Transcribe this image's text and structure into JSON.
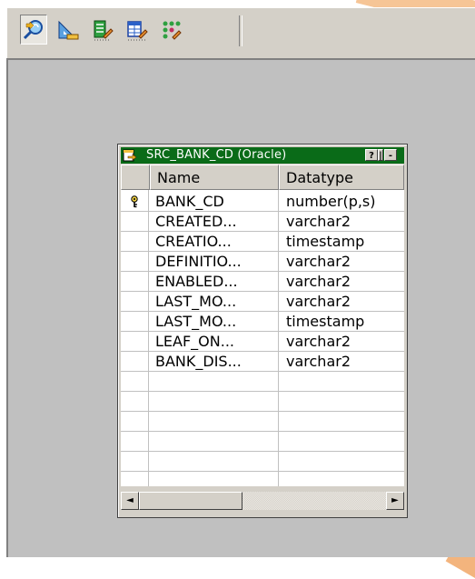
{
  "toolbar": {
    "buttons": [
      {
        "icon": "source-analyzer-icon",
        "pressed": true
      },
      {
        "icon": "target-designer-icon",
        "pressed": false
      },
      {
        "icon": "transformation-developer-icon",
        "pressed": false
      },
      {
        "icon": "mapplet-designer-icon",
        "pressed": false
      },
      {
        "icon": "mapping-designer-icon",
        "pressed": false
      }
    ]
  },
  "source_window": {
    "title": "SRC_BANK_CD (Oracle)",
    "help_glyph": "?",
    "pin_glyph": "|",
    "minimize_glyph": "-",
    "columns": {
      "name": "Name",
      "datatype": "Datatype"
    },
    "rows": [
      {
        "name": "BANK_CD",
        "datatype": "number(p,s)",
        "primary_key": true
      },
      {
        "name": "CREATED...",
        "datatype": "varchar2",
        "primary_key": false
      },
      {
        "name": "CREATIO...",
        "datatype": "timestamp",
        "primary_key": false
      },
      {
        "name": "DEFINITIO...",
        "datatype": "varchar2",
        "primary_key": false
      },
      {
        "name": "ENABLED...",
        "datatype": "varchar2",
        "primary_key": false
      },
      {
        "name": "LAST_MO...",
        "datatype": "varchar2",
        "primary_key": false
      },
      {
        "name": "LAST_MO...",
        "datatype": "timestamp",
        "primary_key": false
      },
      {
        "name": "LEAF_ON...",
        "datatype": "varchar2",
        "primary_key": false
      },
      {
        "name": "BANK_DIS...",
        "datatype": "varchar2",
        "primary_key": false
      }
    ],
    "scroll": {
      "left_arrow": "◄",
      "right_arrow": "►"
    }
  },
  "colors": {
    "title_bar": "#0a6b18",
    "chrome": "#d4d0c8",
    "workspace": "#c0c0c0",
    "accent_orange": "#f6c596"
  }
}
